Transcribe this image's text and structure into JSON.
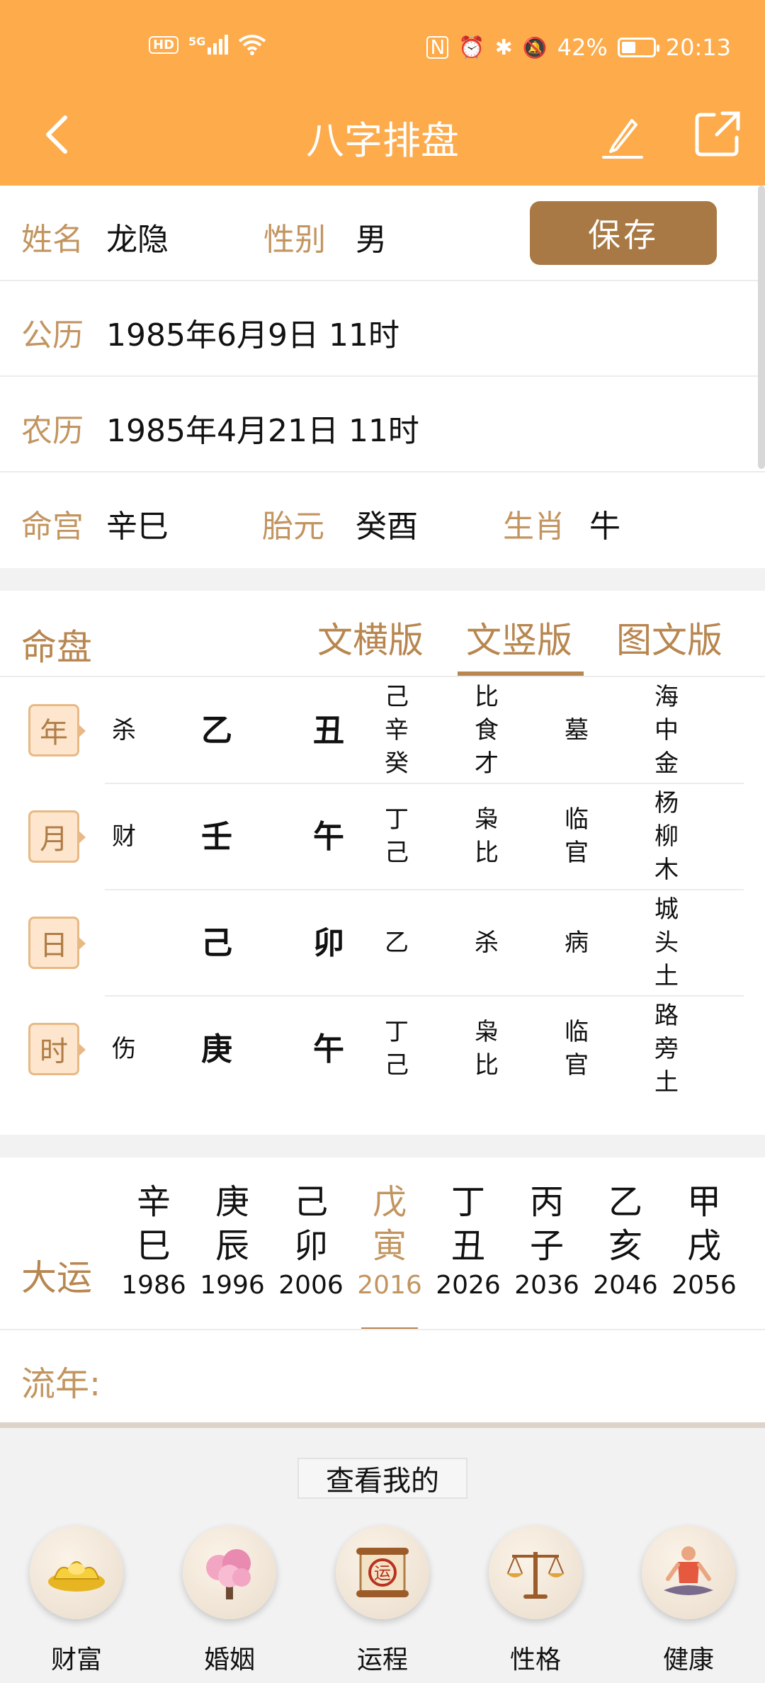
{
  "status": {
    "hd": "HD",
    "signal": "5G",
    "battery": "42%",
    "battery_level": 0.42,
    "time": "20:13"
  },
  "nav": {
    "title": "八字排盘"
  },
  "profile": {
    "name_label": "姓名",
    "name": "龙隐",
    "gender_label": "性别",
    "gender": "男",
    "save": "保存",
    "solar_label": "公历",
    "solar": "1985年6月9日 11时",
    "lunar_label": "农历",
    "lunar": "1985年4月21日 11时",
    "minggong_label": "命宫",
    "minggong": "辛巳",
    "taiyuan_label": "胎元",
    "taiyuan": "癸酉",
    "zodiac_label": "生肖",
    "zodiac": "牛"
  },
  "chart": {
    "title": "命盘",
    "tabs": [
      "文横版",
      "文竖版",
      "图文版"
    ],
    "active_tab": 1,
    "pillars": [
      {
        "tag": "年",
        "shishen": "杀",
        "gan": "乙",
        "zhi": "丑",
        "canggan": [
          "己",
          "辛",
          "癸"
        ],
        "cangshen": [
          "比",
          "食",
          "才"
        ],
        "state": [
          "墓"
        ],
        "nayin": [
          "海",
          "中",
          "金"
        ]
      },
      {
        "tag": "月",
        "shishen": "财",
        "gan": "壬",
        "zhi": "午",
        "canggan": [
          "丁",
          "己"
        ],
        "cangshen": [
          "枭",
          "比"
        ],
        "state": [
          "临",
          "官"
        ],
        "nayin": [
          "杨",
          "柳",
          "木"
        ]
      },
      {
        "tag": "日",
        "shishen": "",
        "gan": "己",
        "zhi": "卯",
        "canggan": [
          "乙"
        ],
        "cangshen": [
          "杀"
        ],
        "state": [
          "病"
        ],
        "nayin": [
          "城",
          "头",
          "土"
        ]
      },
      {
        "tag": "时",
        "shishen": "伤",
        "gan": "庚",
        "zhi": "午",
        "canggan": [
          "丁",
          "己"
        ],
        "cangshen": [
          "枭",
          "比"
        ],
        "state": [
          "临",
          "官"
        ],
        "nayin": [
          "路",
          "旁",
          "土"
        ]
      }
    ]
  },
  "dayun": {
    "label": "大运",
    "items": [
      {
        "gan": "辛",
        "zhi": "巳",
        "year": "1986"
      },
      {
        "gan": "庚",
        "zhi": "辰",
        "year": "1996"
      },
      {
        "gan": "己",
        "zhi": "卯",
        "year": "2006"
      },
      {
        "gan": "戊",
        "zhi": "寅",
        "year": "2016"
      },
      {
        "gan": "丁",
        "zhi": "丑",
        "year": "2026"
      },
      {
        "gan": "丙",
        "zhi": "子",
        "year": "2036"
      },
      {
        "gan": "乙",
        "zhi": "亥",
        "year": "2046"
      },
      {
        "gan": "甲",
        "zhi": "戌",
        "year": "2056"
      }
    ],
    "active": 3,
    "liunian_label": "流年:"
  },
  "bottom": {
    "title": "查看我的",
    "items": [
      {
        "label": "财富",
        "icon": "gold-ingot-icon"
      },
      {
        "label": "婚姻",
        "icon": "blossom-tree-icon"
      },
      {
        "label": "运程",
        "icon": "fortune-scroll-icon"
      },
      {
        "label": "性格",
        "icon": "balance-scale-icon"
      },
      {
        "label": "健康",
        "icon": "meditation-icon"
      }
    ]
  },
  "colors": {
    "brand": "#fdab4b",
    "accent": "#b8864f",
    "button": "#a87944"
  }
}
